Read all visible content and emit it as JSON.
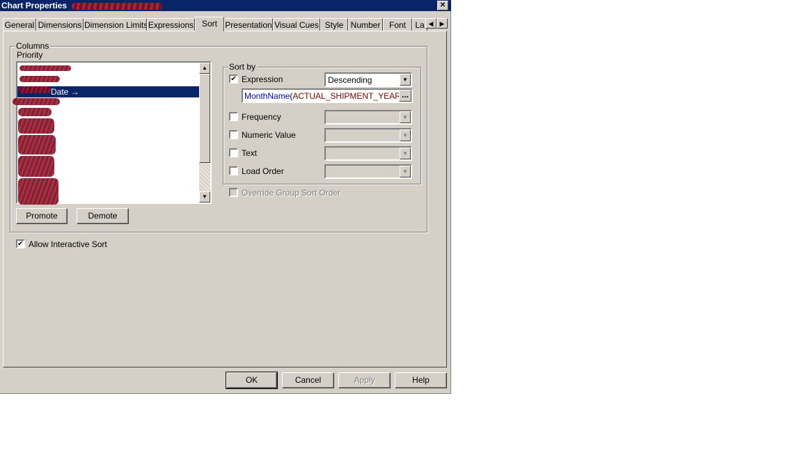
{
  "window": {
    "title": "Chart Properties",
    "close_label": "✕"
  },
  "tabs": [
    {
      "label": "General"
    },
    {
      "label": "Dimensions"
    },
    {
      "label": "Dimension Limits"
    },
    {
      "label": "Expressions"
    },
    {
      "label": "Sort",
      "active": true
    },
    {
      "label": "Presentation"
    },
    {
      "label": "Visual Cues"
    },
    {
      "label": "Style"
    },
    {
      "label": "Number"
    },
    {
      "label": "Font"
    },
    {
      "label": "La"
    }
  ],
  "tab_scroll": {
    "left": "◀",
    "right": "▶"
  },
  "columns": {
    "group_label": "Columns",
    "priority_label": "Priority",
    "list_selected_label": "Date →",
    "promote_label": "Promote",
    "demote_label": "Demote"
  },
  "sort_by": {
    "group_label": "Sort by",
    "expression": {
      "label": "Expression",
      "checked": "✔",
      "order_value": "Descending",
      "expr_function": "MonthName",
      "expr_open": "(",
      "expr_argument": "ACTUAL_SHIPMENT_YEAR_",
      "ellipsis_label": "..."
    },
    "frequency_label": "Frequency",
    "numeric_value_label": "Numeric Value",
    "text_label": "Text",
    "load_order_label": "Load Order",
    "override_label": "Override Group Sort Order"
  },
  "allow_interactive_sort": {
    "label": "Allow Interactive Sort",
    "checked": "✔"
  },
  "footer": {
    "ok_label": "OK",
    "cancel_label": "Cancel",
    "apply_label": "Apply",
    "help_label": "Help"
  },
  "icons": {
    "arrow_up": "▲",
    "arrow_down": "▼"
  },
  "colors": {
    "titlebar": "#0a246a",
    "dialog_bg": "#d4d0c8",
    "selection": "#0a246a",
    "redaction": "#a01830"
  }
}
